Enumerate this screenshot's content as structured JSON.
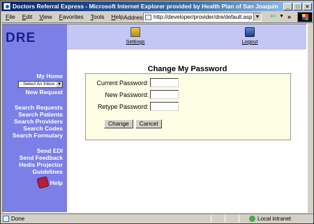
{
  "window": {
    "title": "Doctors Referral Express - Microsoft Internet Explorer provided by Health Plan of San Joaquin",
    "controls": [
      "_",
      "□",
      "×"
    ]
  },
  "menubar": {
    "items": [
      "File",
      "Edit",
      "View",
      "Favorites",
      "Tools",
      "Help"
    ],
    "address_label": "Address",
    "address_value": "http://developer/provider/dre/default.asp"
  },
  "logo": "DRE",
  "topnav": {
    "settings": "Settings",
    "logout": "Logout"
  },
  "sidebar": {
    "my_home": "My Home",
    "inbox_select": "- Select An Inbox -",
    "new_request": "New Request",
    "group1": [
      "Search Requests",
      "Search Patients",
      "Search Providers",
      "Search Codes",
      "Search Formulary"
    ],
    "group2": [
      "Send EDI",
      "Send Feedback",
      "Hedis Projector",
      "Guidelines"
    ],
    "help": "Help"
  },
  "form": {
    "title": "Change My Password",
    "current_label": "Current Password:",
    "new_label": "New Password:",
    "retype_label": "Retype Password:",
    "change_button": "Change",
    "cancel_button": "Cancel"
  },
  "status": {
    "left": "Done",
    "zone": "Local intranet"
  },
  "colors": {
    "sidebar": "#7b7fe6",
    "topbar": "#c4c7f3",
    "form_bg": "#fefee5",
    "logo": "#1a1e8c"
  }
}
